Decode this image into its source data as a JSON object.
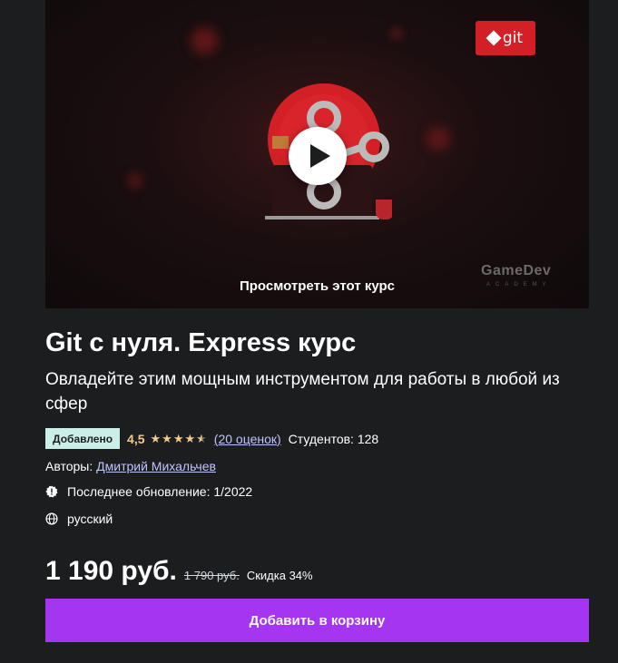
{
  "preview": {
    "caption": "Просмотреть этот курс",
    "logo_text": "git",
    "brand_text": "GameDev",
    "brand_sub": "ACADEMY",
    "play_icon": "play-icon"
  },
  "course": {
    "title": "Git с нуля. Express курс",
    "subtitle": "Овладейте этим мощным инструментом для работы в любой из сфер"
  },
  "rating": {
    "badge": "Добавлено",
    "value": "4,5",
    "stars": 4.5,
    "reviews": "(20 оценок)",
    "students": "Студентов: 128"
  },
  "authors": {
    "label": "Авторы:",
    "name": "Дмитрий Михальчев"
  },
  "meta": {
    "updated": "Последнее обновление: 1/2022",
    "language": "русский",
    "updated_icon": "alert-badge-icon",
    "language_icon": "globe-icon"
  },
  "price": {
    "current": "1 190 руб.",
    "old": "1 790 руб.",
    "discount": "Скидка 34%"
  },
  "cart": {
    "label": "Добавить в корзину"
  },
  "colors": {
    "background": "#1c1d1f",
    "accent": "#a435f0",
    "star": "#f3ca8c",
    "link": "#c0c4fc",
    "badge": "#cceee9"
  }
}
